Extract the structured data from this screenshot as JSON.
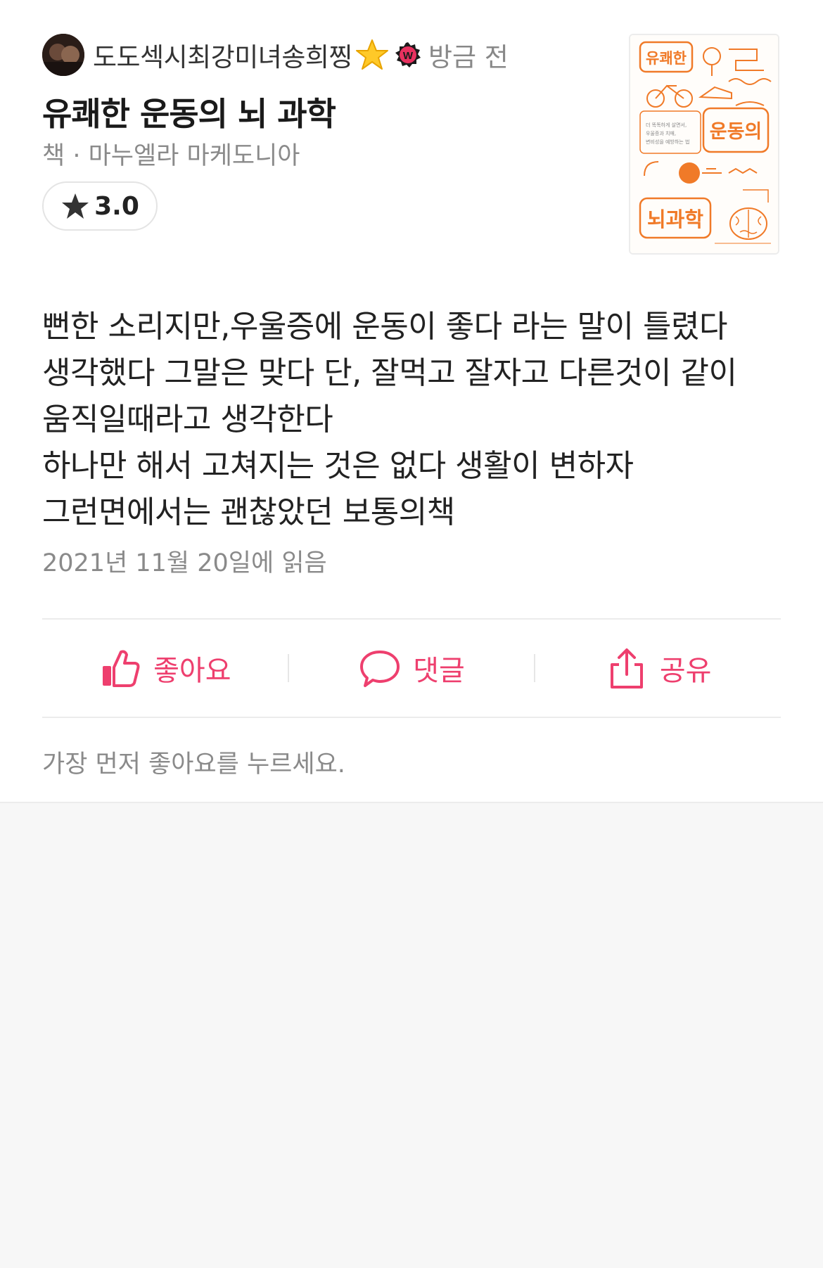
{
  "post": {
    "username": "도도섹시최강미녀송희찡",
    "time": "방금 전",
    "badge_letter": "W"
  },
  "book": {
    "title": "유쾌한 운동의 뇌 과학",
    "meta": "책 · 마누엘라 마케도니아",
    "cover": {
      "title_line1": "유쾌한",
      "title_line2": "운동의",
      "title_line3": "뇌과학",
      "tagline": "더 똑똑하게 살면서, 우울증과 치매, 변비성을 예방하는 법",
      "accent": "#f07a28"
    }
  },
  "rating": {
    "value": "3.0"
  },
  "review": {
    "lines": [
      "뻔한 소리지만,우울증에 운동이 좋다 라는 말이 틀렸다",
      "생각했다 그말은 맞다 단, 잘먹고 잘자고 다른것이 같이",
      "움직일때라고 생각한다",
      "하나만 해서 고쳐지는 것은 없다 생활이 변하자",
      "그런면에서는 괜찮았던 보통의책"
    ],
    "read_date": "2021년 11월 20일에 읽음"
  },
  "actions": {
    "like_label": "좋아요",
    "comment_label": "댓글",
    "share_label": "공유"
  },
  "footer": {
    "first_like_text": "가장 먼저 좋아요를 누르세요."
  },
  "colors": {
    "accent": "#ee3f6e",
    "muted_text": "#8a8a8a",
    "divider": "#ececec"
  },
  "icons": {
    "avatar": "user-avatar",
    "star_emoji": "star-emoji-icon",
    "badge": "w-badge-icon",
    "rating_star": "star-icon",
    "like": "thumbs-up-icon",
    "comment": "speech-bubble-icon",
    "share": "share-icon"
  }
}
